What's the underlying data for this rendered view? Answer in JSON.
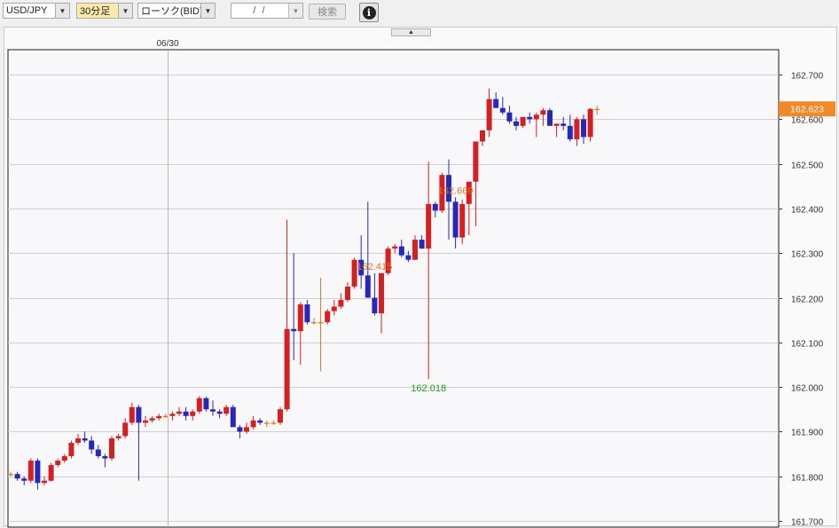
{
  "toolbar": {
    "pair": "USD/JPY",
    "timeframe": "30分足",
    "chart_type": "ローソク(BID)",
    "date_placeholder": "/ /",
    "search_label": "検索",
    "info_label": "i"
  },
  "colors": {
    "up": "#d42020",
    "down": "#2828b8",
    "doji": "#d07a10",
    "current_price_bg": "#f08a28"
  },
  "chart_data": {
    "type": "candlestick",
    "date_label": "06/30",
    "ylim": [
      161.69,
      162.76
    ],
    "yticks": [
      "162.700",
      "162.600",
      "162.500",
      "162.400",
      "162.300",
      "162.200",
      "162.100",
      "162.000",
      "161.900",
      "161.800",
      "161.700"
    ],
    "current_price": "162.623",
    "annotations": [
      {
        "text": "162.669",
        "type": "high",
        "index": 66
      },
      {
        "text": "162.415",
        "type": "high",
        "index": 54
      },
      {
        "text": "162.018",
        "type": "low",
        "index": 62
      }
    ],
    "candles": [
      [
        161.805,
        161.81,
        161.8,
        161.805
      ],
      [
        161.805,
        161.81,
        161.79,
        161.795
      ],
      [
        161.795,
        161.8,
        161.78,
        161.79
      ],
      [
        161.79,
        161.84,
        161.785,
        161.835
      ],
      [
        161.835,
        161.84,
        161.77,
        161.785
      ],
      [
        161.785,
        161.8,
        161.78,
        161.79
      ],
      [
        161.79,
        161.83,
        161.788,
        161.825
      ],
      [
        161.825,
        161.84,
        161.82,
        161.835
      ],
      [
        161.835,
        161.85,
        161.83,
        161.845
      ],
      [
        161.845,
        161.88,
        161.84,
        161.875
      ],
      [
        161.875,
        161.895,
        161.87,
        161.885
      ],
      [
        161.885,
        161.9,
        161.875,
        161.88
      ],
      [
        161.88,
        161.89,
        161.85,
        161.86
      ],
      [
        161.86,
        161.87,
        161.84,
        161.845
      ],
      [
        161.845,
        161.85,
        161.82,
        161.84
      ],
      [
        161.84,
        161.89,
        161.835,
        161.885
      ],
      [
        161.885,
        161.895,
        161.88,
        161.89
      ],
      [
        161.89,
        161.93,
        161.885,
        161.92
      ],
      [
        161.92,
        161.965,
        161.915,
        161.955
      ],
      [
        161.955,
        161.96,
        161.79,
        161.92
      ],
      [
        161.92,
        161.935,
        161.91,
        161.925
      ],
      [
        161.925,
        161.935,
        161.92,
        161.93
      ],
      [
        161.93,
        161.94,
        161.925,
        161.935
      ],
      [
        161.935,
        161.94,
        161.93,
        161.935
      ],
      [
        161.935,
        161.945,
        161.925,
        161.94
      ],
      [
        161.94,
        161.955,
        161.935,
        161.945
      ],
      [
        161.945,
        161.955,
        161.925,
        161.935
      ],
      [
        161.935,
        161.95,
        161.925,
        161.945
      ],
      [
        161.945,
        161.98,
        161.94,
        161.975
      ],
      [
        161.975,
        161.978,
        161.945,
        161.95
      ],
      [
        161.95,
        161.97,
        161.935,
        161.945
      ],
      [
        161.945,
        161.95,
        161.93,
        161.94
      ],
      [
        161.94,
        161.96,
        161.935,
        161.955
      ],
      [
        161.955,
        161.96,
        161.915,
        161.91
      ],
      [
        161.91,
        161.915,
        161.885,
        161.9
      ],
      [
        161.9,
        161.92,
        161.895,
        161.91
      ],
      [
        161.91,
        161.935,
        161.905,
        161.925
      ],
      [
        161.925,
        161.93,
        161.915,
        161.92
      ],
      [
        161.92,
        161.925,
        161.91,
        161.92
      ],
      [
        161.92,
        161.925,
        161.915,
        161.92
      ],
      [
        161.92,
        161.955,
        161.915,
        161.95
      ],
      [
        161.95,
        162.375,
        161.945,
        162.13
      ],
      [
        162.13,
        162.3,
        162.06,
        162.125
      ],
      [
        162.125,
        162.19,
        162.05,
        162.185
      ],
      [
        162.185,
        162.195,
        162.14,
        162.145
      ],
      [
        162.145,
        162.155,
        162.14,
        162.145
      ],
      [
        162.145,
        162.245,
        162.035,
        162.145
      ],
      [
        162.145,
        162.175,
        162.14,
        162.17
      ],
      [
        162.17,
        162.195,
        162.16,
        162.18
      ],
      [
        162.18,
        162.21,
        162.175,
        162.195
      ],
      [
        162.195,
        162.235,
        162.19,
        162.225
      ],
      [
        162.225,
        162.29,
        162.22,
        162.285
      ],
      [
        162.285,
        162.34,
        162.22,
        162.25
      ],
      [
        162.25,
        162.415,
        162.23,
        162.2
      ],
      [
        162.2,
        162.255,
        162.16,
        162.165
      ],
      [
        162.165,
        162.255,
        162.12,
        162.255
      ],
      [
        162.255,
        162.315,
        162.25,
        162.31
      ],
      [
        162.31,
        162.32,
        162.3,
        162.315
      ],
      [
        162.315,
        162.33,
        162.29,
        162.295
      ],
      [
        162.295,
        162.305,
        162.28,
        162.285
      ],
      [
        162.285,
        162.34,
        162.285,
        162.33
      ],
      [
        162.33,
        162.34,
        162.31,
        162.31
      ],
      [
        162.31,
        162.505,
        162.018,
        162.41
      ],
      [
        162.41,
        162.415,
        162.38,
        162.395
      ],
      [
        162.395,
        162.48,
        162.39,
        162.475
      ],
      [
        162.475,
        162.51,
        162.33,
        162.415
      ],
      [
        162.415,
        162.425,
        162.31,
        162.335
      ],
      [
        162.335,
        162.42,
        162.32,
        162.41
      ],
      [
        162.41,
        162.455,
        162.34,
        162.46
      ],
      [
        162.46,
        162.52,
        162.36,
        162.55
      ],
      [
        162.55,
        162.575,
        162.54,
        162.575
      ],
      [
        162.575,
        162.669,
        162.56,
        162.645
      ],
      [
        162.645,
        162.66,
        162.63,
        162.625
      ],
      [
        162.625,
        162.65,
        162.61,
        162.615
      ],
      [
        162.615,
        162.63,
        162.59,
        162.595
      ],
      [
        162.595,
        162.605,
        162.575,
        162.585
      ],
      [
        162.585,
        162.6,
        162.58,
        162.605
      ],
      [
        162.605,
        162.615,
        162.59,
        162.6
      ],
      [
        162.6,
        162.615,
        162.56,
        162.61
      ],
      [
        162.61,
        162.625,
        162.585,
        162.62
      ],
      [
        162.62,
        162.625,
        162.6,
        162.585
      ],
      [
        162.585,
        162.59,
        162.56,
        162.59
      ],
      [
        162.59,
        162.605,
        162.575,
        162.585
      ],
      [
        162.585,
        162.61,
        162.55,
        162.555
      ],
      [
        162.555,
        162.605,
        162.54,
        162.6
      ],
      [
        162.6,
        162.61,
        162.545,
        162.56
      ],
      [
        162.56,
        162.625,
        162.55,
        162.623
      ],
      [
        162.623,
        162.63,
        162.61,
        162.623
      ]
    ]
  }
}
